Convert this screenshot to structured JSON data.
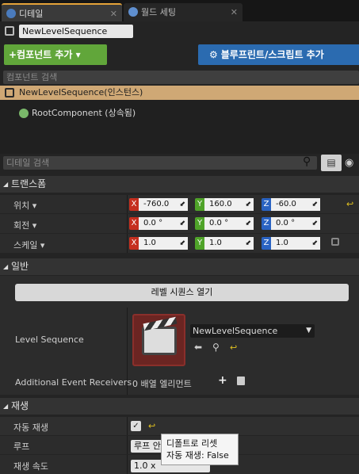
{
  "tabs": [
    {
      "label": "디테일",
      "icon": "search-icon",
      "close": "✕"
    },
    {
      "label": "월드 세팅",
      "icon": "globe-icon",
      "close": "✕"
    }
  ],
  "actor_name": "NewLevelSequence",
  "toolbar": {
    "add_component": "+컴포넌트 추가 ▾",
    "blueprint_script": "블루프린트/스크립트 추가"
  },
  "component_search": {
    "placeholder": "컴포넌트 검색"
  },
  "components": {
    "instance_row": "NewLevelSequence(인스턴스)",
    "root": "RootComponent (상속됨)"
  },
  "detail_search": {
    "placeholder": "디테일 검색"
  },
  "transform": {
    "header": "트랜스폼",
    "location": {
      "label": "위치 ▾",
      "x": "-760.0",
      "y": "160.0",
      "z": "-60.0"
    },
    "rotation": {
      "label": "회전 ▾",
      "x": "0.0 °",
      "y": "0.0 °",
      "z": "0.0 °"
    },
    "scale": {
      "label": "스케일 ▾",
      "x": "1.0",
      "y": "1.0",
      "z": "1.0"
    },
    "axis_labels": {
      "x": "X",
      "y": "Y",
      "z": "Z"
    }
  },
  "general": {
    "header": "일반",
    "open_button": "레벨 시퀀스 열기",
    "level_sequence_label": "Level Sequence",
    "level_sequence_value": "NewLevelSequence",
    "event_receivers_label": "Additional Event Receivers",
    "event_receivers_value": "0 배열 엘리먼트"
  },
  "playback": {
    "header": "재생",
    "auto_play_label": "자동 재생",
    "auto_play_checked": "✓",
    "loop_label": "루프",
    "loop_value": "루프 안",
    "speed_label": "재생 속도",
    "speed_value": "1.0 x"
  },
  "tooltip": {
    "line1": "디폴트로 리셋",
    "line2": "자동 재생: False"
  },
  "colors": {
    "accent_orange": "#e5a339",
    "add_green": "#61a63a",
    "blueprint_blue": "#2b6bb0",
    "instance_tan": "#cfa875",
    "axis_x": "#c52f1f",
    "axis_y": "#4fa329",
    "axis_z": "#2a63c2"
  }
}
